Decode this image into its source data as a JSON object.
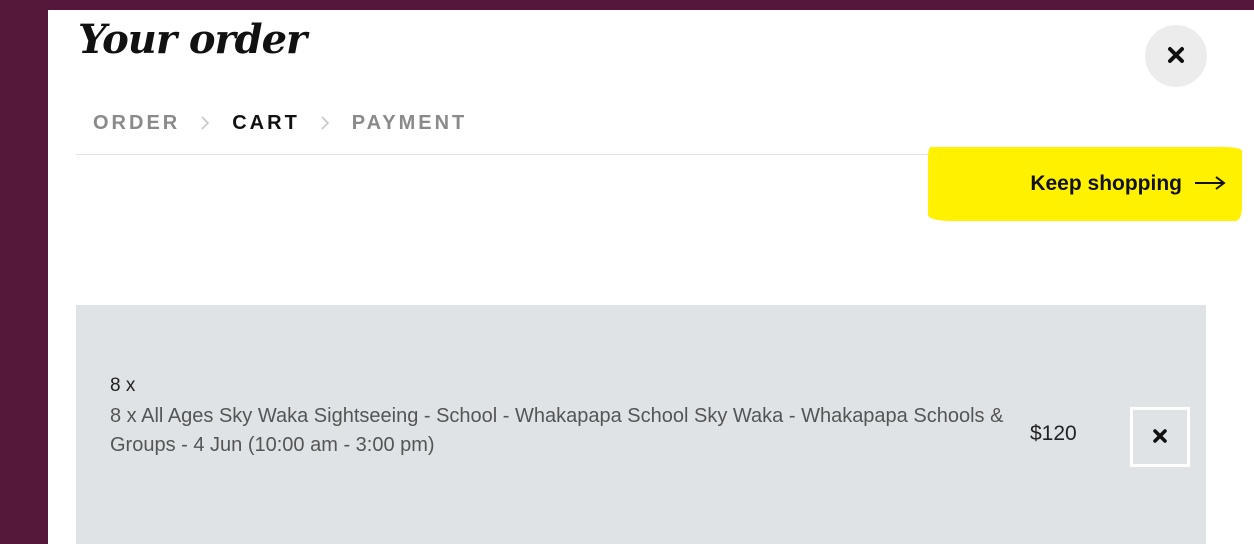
{
  "modal": {
    "title": "Your order"
  },
  "breadcrumb": {
    "steps": [
      "ORDER",
      "CART",
      "PAYMENT"
    ],
    "current": "CART"
  },
  "keep_shopping": {
    "label": "Keep shopping",
    "icon": "arrow-right-icon",
    "highlight_color": "#fff100"
  },
  "cart": {
    "items": [
      {
        "quantity": "8 x",
        "description": "8 x All Ages Sky Waka Sightseeing - School - Whakapapa School Sky Waka - Whakapapa Schools & Groups - 4 Jun (10:00 am - 3:00 pm)",
        "price": "$120",
        "remove_icon": "close-icon"
      }
    ]
  },
  "icons": {
    "close_modal": "close-icon"
  },
  "colors": {
    "backdrop": "#5a1b3c",
    "panel": "#ffffff",
    "cart_background": "#dfe3e5",
    "breadcrumb_inactive": "#8a8a8a",
    "breadcrumb_active": "#111111"
  }
}
